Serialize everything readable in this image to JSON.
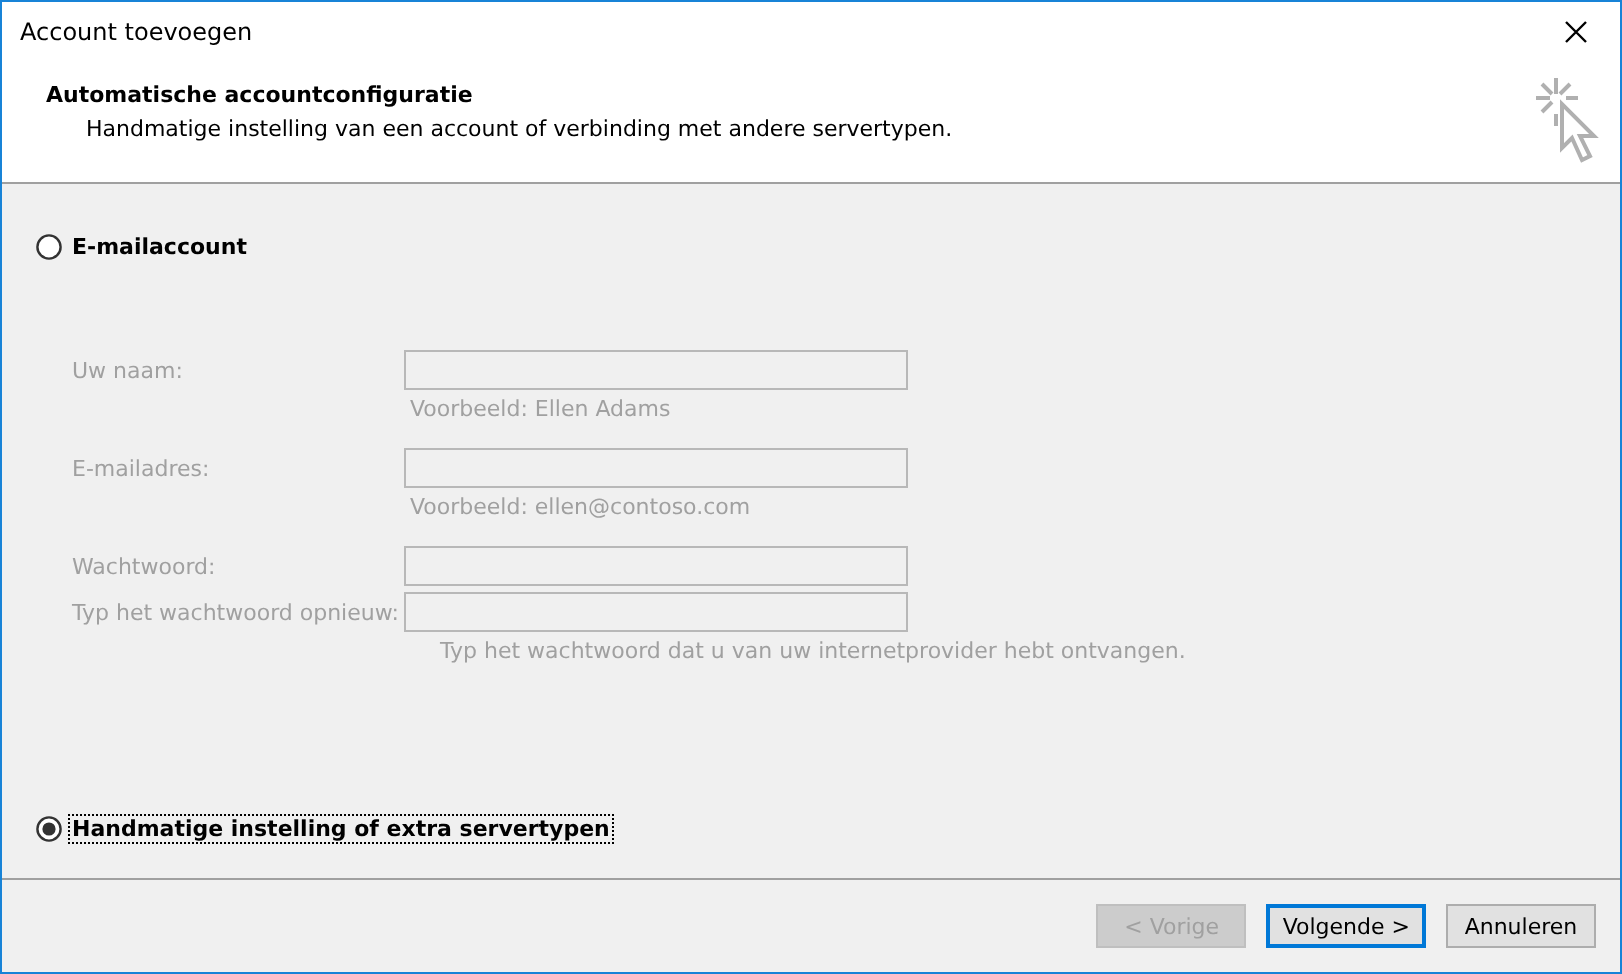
{
  "window": {
    "title": "Account toevoegen"
  },
  "header": {
    "title": "Automatische accountconfiguratie",
    "subtitle": "Handmatige instelling van een account of verbinding met andere servertypen."
  },
  "email_option": {
    "label": "E-mailaccount",
    "selected": false,
    "focused": false
  },
  "fields": [
    {
      "label": "Uw naam:",
      "disabled": true,
      "hint": "Voorbeeld: Ellen Adams"
    },
    {
      "label": "E-mailadres:",
      "disabled": true,
      "hint": "Voorbeeld: ellen@contoso.com"
    },
    {
      "label": "Wachtwoord:",
      "disabled": true
    },
    {
      "label": "Typ het wachtwoord opnieuw:",
      "disabled": true,
      "hint": "Typ het wachtwoord dat u van uw internetprovider hebt ontvangen."
    }
  ],
  "manual_option": {
    "label": "Handmatige instelling of extra servertypen",
    "selected": true,
    "focused": true
  },
  "buttons": [
    {
      "label": "< Vorige",
      "disabled": true,
      "default": false
    },
    {
      "label": "Volgende >",
      "disabled": false,
      "default": true
    },
    {
      "label": "Annuleren",
      "disabled": false,
      "default": false
    }
  ]
}
